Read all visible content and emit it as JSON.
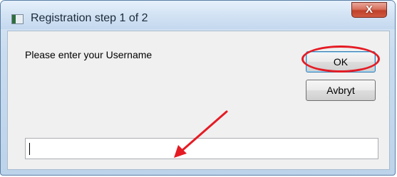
{
  "window": {
    "title": "Registration step 1 of 2",
    "close_label": "X"
  },
  "dialog": {
    "prompt": "Please enter your Username",
    "ok_label": "OK",
    "cancel_label": "Avbryt",
    "username_value": ""
  },
  "annotations": {
    "highlight_color": "#e51b24",
    "highlight_target": "ok-button",
    "arrow_target": "username-input"
  }
}
